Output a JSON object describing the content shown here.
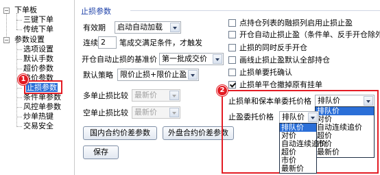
{
  "tree": {
    "nodes": [
      {
        "label": "下单板",
        "expander": "−"
      },
      {
        "label": "三键下单"
      },
      {
        "label": "传统下单"
      },
      {
        "label": "参数设置",
        "expander": "−"
      },
      {
        "label": "选项设置"
      },
      {
        "label": "默认手数"
      },
      {
        "label": "超价参数"
      },
      {
        "label": "追价参数"
      },
      {
        "label": "止损参数",
        "selected": true
      },
      {
        "label": "条件单参数"
      },
      {
        "label": "风控单参数"
      },
      {
        "label": "炒单热键"
      },
      {
        "label": "交易安全"
      }
    ]
  },
  "badges": {
    "one": "1",
    "two": "2"
  },
  "panel": {
    "group_title": "止损参数",
    "validity_label": "有效期",
    "validity_value": "启动自动加载",
    "serial_label": "连续",
    "serial_value": "2",
    "serial_suffix": "笔成交满足条件，才触发",
    "auto_stop_price_label": "开仓自动止损的基准价",
    "auto_stop_price_value": "第一批成交价",
    "default_strategy_label": "默认策略",
    "default_strategy_value": "限价止损+限价止盈",
    "multi_stop_label": "多单止损比较",
    "multi_stop_value": "最新价",
    "short_stop_label": "空单止损比较",
    "short_stop_value": "最新价",
    "domestic_button": "国内合约价差参数",
    "foreign_button": "外盘合约价差参数",
    "save_button": "保存"
  },
  "options": [
    {
      "label": "点持仓列表的融损列启用止损止盈",
      "checked": false
    },
    {
      "label": "开仓自动止损止盈（条件单、反手开仓除外）",
      "checked": false
    },
    {
      "label": "止损的同时反手开仓",
      "checked": false
    },
    {
      "label": "画线止损止盈默认全部持仓",
      "checked": false
    },
    {
      "label": "止损单要托确认",
      "checked": false
    },
    {
      "label": "止损单平仓撤掉原有挂单",
      "checked": true
    }
  ],
  "highlight": {
    "stop_order_label": "止损单和保本单委托价格",
    "stop_order_value": "排队价",
    "take_profit_label": "止盈委托价格",
    "take_profit_value": "排队价",
    "right_options": [
      "排队价",
      "对价",
      "自动连续追价",
      "超价",
      "市价",
      "最新价"
    ],
    "left_options": [
      "排队价",
      "对价",
      "自动连续追价",
      "超价",
      "市价",
      "最新价"
    ]
  }
}
